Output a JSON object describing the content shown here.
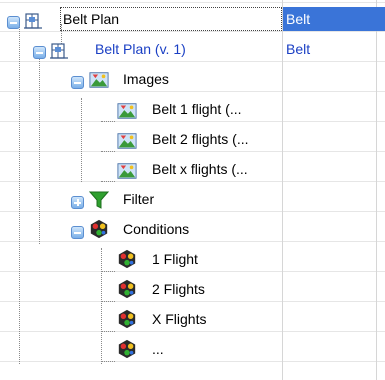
{
  "tree": {
    "rows": [
      {
        "label": "Belt Plan",
        "value": "Belt",
        "icon": "plan-icon",
        "toggle": "minus"
      },
      {
        "label": "Belt Plan (v. 1)",
        "value": "Belt",
        "icon": "plan-icon",
        "toggle": "minus"
      },
      {
        "label": "Images",
        "icon": "image-icon",
        "toggle": "minus"
      },
      {
        "label": "Belt 1 flight (...",
        "icon": "image-icon"
      },
      {
        "label": "Belt 2 flights (...",
        "icon": "image-icon"
      },
      {
        "label": "Belt x flights (...",
        "icon": "image-icon"
      },
      {
        "label": "Filter",
        "icon": "filter-icon",
        "toggle": "plus"
      },
      {
        "label": "Conditions",
        "icon": "conditions-icon",
        "toggle": "minus"
      },
      {
        "label": "1 Flight",
        "icon": "conditions-icon"
      },
      {
        "label": "2 Flights",
        "icon": "conditions-icon"
      },
      {
        "label": "X Flights",
        "icon": "conditions-icon"
      },
      {
        "label": "...",
        "icon": "conditions-icon"
      }
    ]
  },
  "colors": {
    "selection": "#3a74d8",
    "link_blue": "#1a3fc4",
    "toggle_blue": "#79aee8"
  }
}
